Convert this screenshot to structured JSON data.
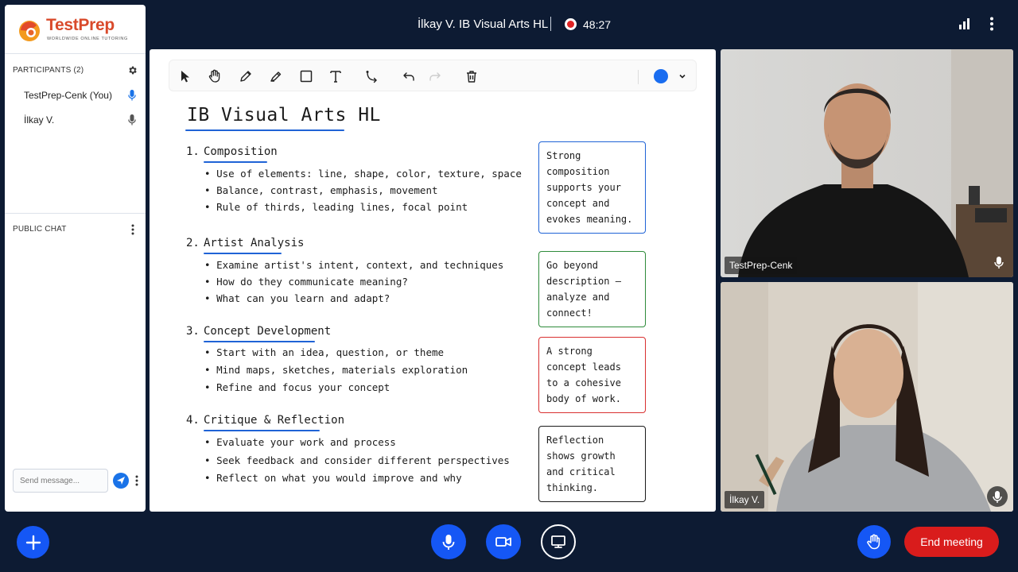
{
  "header": {
    "meeting_title": "İlkay V. IB Visual Arts HL",
    "timer": "48:27",
    "recording_color": "#e02424"
  },
  "brand": {
    "name": "TestPrep",
    "tagline": "WORLDWIDE ONLINE TUTORING"
  },
  "participants": {
    "heading": "PARTICIPANTS (2)",
    "items": [
      {
        "name": "TestPrep-Cenk (You)",
        "mic": "mic-active-icon"
      },
      {
        "name": "İlkay V.",
        "mic": "mic-icon"
      }
    ]
  },
  "chat": {
    "heading": "PUBLIC CHAT",
    "input_placeholder": "Send message..."
  },
  "toolbar": {
    "tools": [
      "select-icon",
      "hand-icon",
      "pencil-icon",
      "highlighter-icon",
      "rectangle-icon",
      "text-icon",
      "connector-icon",
      "undo-icon",
      "redo-icon",
      "trash-icon"
    ],
    "current_color": "#1a6df0"
  },
  "whiteboard": {
    "title": "IB Visual Arts HL",
    "sections": [
      {
        "number": "1.",
        "heading": "Composition",
        "bullets": [
          "Use of elements: line, shape, color, texture, space",
          "Balance, contrast, emphasis, movement",
          "Rule of thirds, leading lines, focal point"
        ],
        "note": "Strong composition supports your concept and evokes meaning.",
        "note_color": "#1f63d6"
      },
      {
        "number": "2.",
        "heading": "Artist Analysis",
        "bullets": [
          "Examine artist's intent, context, and techniques",
          "How do they communicate meaning?",
          "What can you learn and adapt?"
        ],
        "note": "Go beyond description – analyze and connect!",
        "note_color": "#2e8b3a"
      },
      {
        "number": "3.",
        "heading": "Concept Development",
        "bullets": [
          "Start with an idea, question, or theme",
          "Mind maps, sketches, materials exploration",
          "Refine and focus your concept"
        ],
        "note": "A strong concept leads to a cohesive body of work.",
        "note_color": "#d93030"
      },
      {
        "number": "4.",
        "heading": "Critique & Reflection",
        "bullets": [
          "Evaluate your work and process",
          "Seek feedback and consider different perspectives",
          "Reflect on what you would improve and why"
        ],
        "note": "Reflection shows growth and critical thinking.",
        "note_color": "#1b1b1b"
      }
    ]
  },
  "videos": [
    {
      "name": "TestPrep-Cenk"
    },
    {
      "name": "İlkay V."
    }
  ],
  "controls": {
    "end_meeting_label": "End meeting",
    "primary_color": "#1557f5",
    "danger_color": "#d91c1c"
  }
}
